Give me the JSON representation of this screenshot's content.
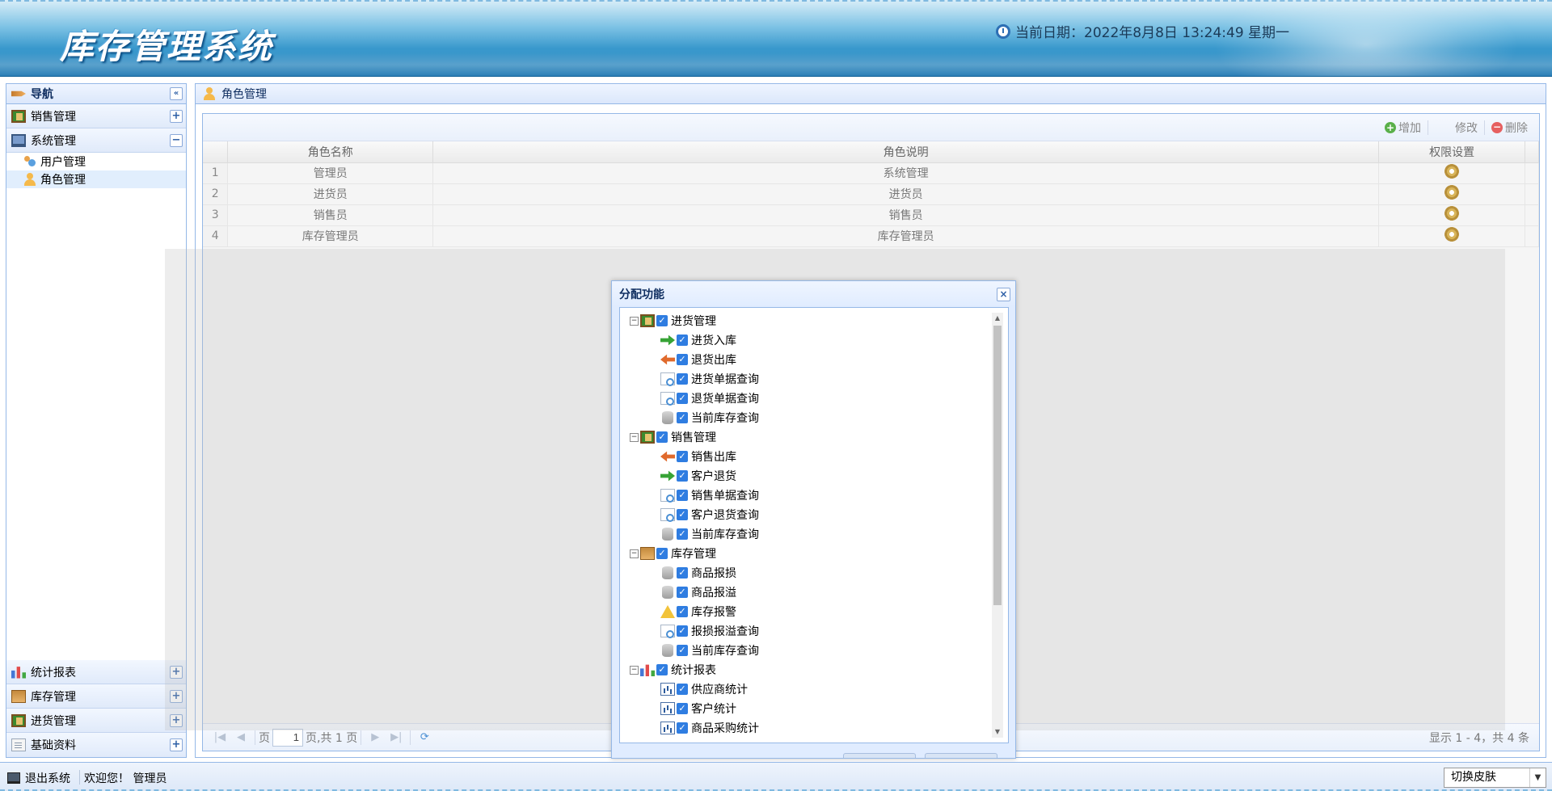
{
  "header": {
    "title": "库存管理系统",
    "date_text": "当前日期：2022年8月8日 13:24:49 星期一"
  },
  "nav": {
    "title": "导航",
    "collapse_glyph": "«",
    "groups_top": [
      {
        "label": "销售管理",
        "icon": "door-icon",
        "state": "+"
      },
      {
        "label": "系统管理",
        "icon": "monitor-icon",
        "state": "−"
      }
    ],
    "system_items": [
      {
        "label": "用户管理",
        "icon": "users-icon"
      },
      {
        "label": "角色管理",
        "icon": "user-icon",
        "selected": true
      }
    ],
    "groups_bottom": [
      {
        "label": "统计报表",
        "icon": "chart-icon",
        "state": "+"
      },
      {
        "label": "库存管理",
        "icon": "box-icon",
        "state": "+"
      },
      {
        "label": "进货管理",
        "icon": "door-icon",
        "state": "+"
      },
      {
        "label": "基础资料",
        "icon": "doc-icon",
        "state": "+"
      }
    ]
  },
  "main": {
    "title": "角色管理",
    "toolbar": {
      "add": "增加",
      "edit": "修改",
      "delete": "删除"
    },
    "columns": [
      "角色名称",
      "角色说明",
      "权限设置"
    ],
    "rows": [
      {
        "n": "1",
        "name": "管理员",
        "desc": "系统管理"
      },
      {
        "n": "2",
        "name": "进货员",
        "desc": "进货员"
      },
      {
        "n": "3",
        "name": "销售员",
        "desc": "销售员"
      },
      {
        "n": "4",
        "name": "库存管理员",
        "desc": "库存管理员"
      }
    ],
    "pager": {
      "page_label": "页",
      "page_value": "1",
      "total_text": "页,共 1 页",
      "info": "显示 1 - 4，共 4 条"
    }
  },
  "dialog": {
    "title": "分配功能",
    "tree": [
      {
        "label": "进货管理",
        "icon": "door-icon",
        "children": [
          {
            "label": "进货入库",
            "icon": "arrow-in-icon"
          },
          {
            "label": "退货出库",
            "icon": "arrow-out-icon"
          },
          {
            "label": "进货单据查询",
            "icon": "search-doc-icon"
          },
          {
            "label": "退货单据查询",
            "icon": "search-doc-icon"
          },
          {
            "label": "当前库存查询",
            "icon": "database-icon"
          }
        ]
      },
      {
        "label": "销售管理",
        "icon": "door-icon",
        "children": [
          {
            "label": "销售出库",
            "icon": "arrow-out-icon"
          },
          {
            "label": "客户退货",
            "icon": "arrow-in-icon"
          },
          {
            "label": "销售单据查询",
            "icon": "search-doc-icon"
          },
          {
            "label": "客户退货查询",
            "icon": "search-doc-icon"
          },
          {
            "label": "当前库存查询",
            "icon": "database-icon"
          }
        ]
      },
      {
        "label": "库存管理",
        "icon": "box-icon",
        "children": [
          {
            "label": "商品报损",
            "icon": "database-icon"
          },
          {
            "label": "商品报溢",
            "icon": "database-icon"
          },
          {
            "label": "库存报警",
            "icon": "warning-icon"
          },
          {
            "label": "报损报溢查询",
            "icon": "search-doc-icon"
          },
          {
            "label": "当前库存查询",
            "icon": "database-icon"
          }
        ]
      },
      {
        "label": "统计报表",
        "icon": "chart-icon",
        "children": [
          {
            "label": "供应商统计",
            "icon": "bar-report-icon"
          },
          {
            "label": "客户统计",
            "icon": "bar-report-icon"
          },
          {
            "label": "商品采购统计",
            "icon": "bar-report-icon"
          }
        ]
      }
    ]
  },
  "footer": {
    "logout": "退出系统",
    "welcome": "欢迎您！ 管理员",
    "skin_select": "切换皮肤"
  }
}
